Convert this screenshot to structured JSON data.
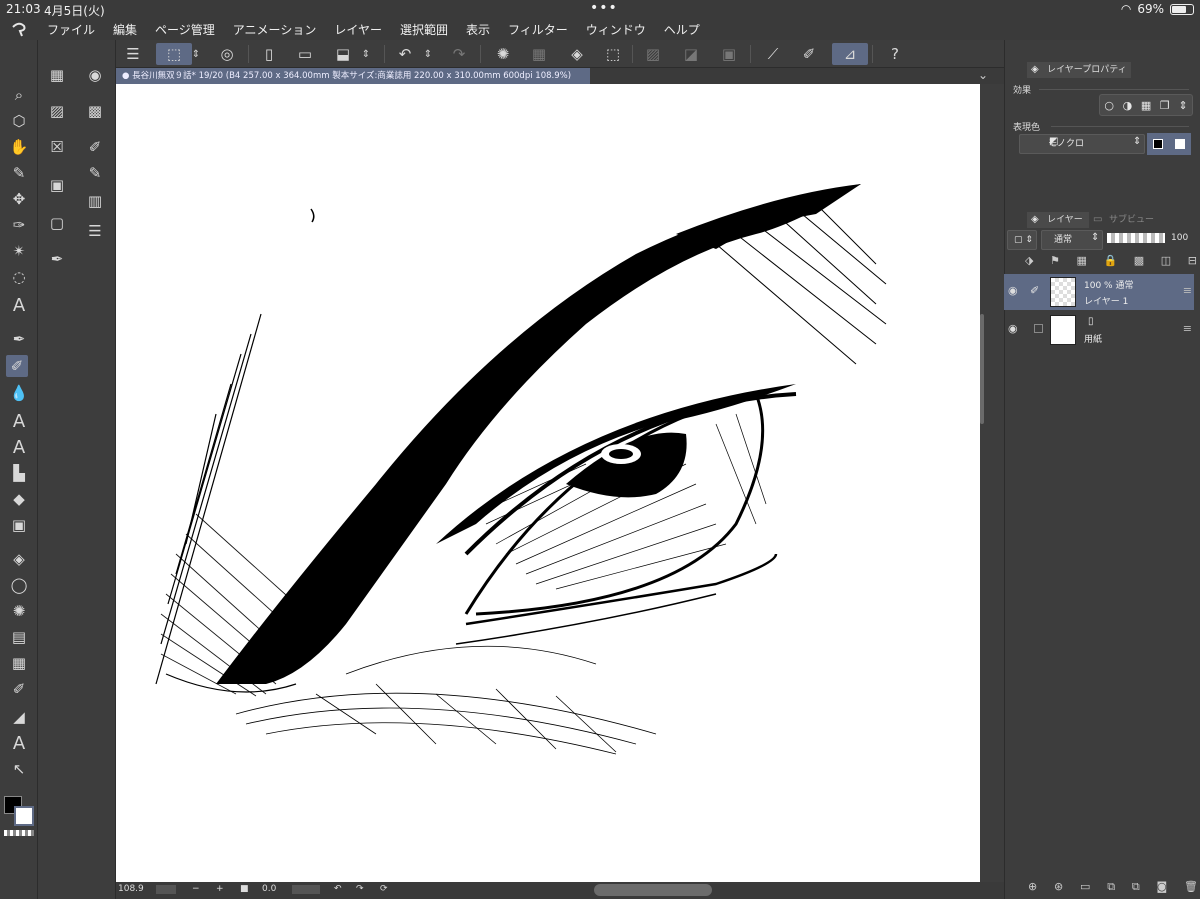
{
  "status_bar": {
    "time": "21:03",
    "date": "4月5日(火)",
    "dots": "•••",
    "battery": "69%",
    "battery_level": 0.69
  },
  "menu": {
    "items": [
      "ファイル",
      "編集",
      "ページ管理",
      "アニメーション",
      "レイヤー",
      "選択範囲",
      "表示",
      "フィルター",
      "ウィンドウ",
      "ヘルプ"
    ]
  },
  "canvas": {
    "document_tab": "長谷川無双９話* 19/20 (B4 257.00 x 364.00mm 製本サイズ:商業誌用 220.00 x 310.00mm 600dpi 108.9%)",
    "zoom": "108.9",
    "rotation": "0.0"
  },
  "layer_property": {
    "tab_label": "レイヤープロパティ",
    "effect_label": "効果",
    "expression_color_label": "表現色",
    "expression_color_value": "モノクロ"
  },
  "layers_panel": {
    "tab_label": "レイヤー",
    "tab2_label": "サブビュー",
    "blend_mode": "通常",
    "opacity": "100",
    "layers": [
      {
        "line1": "100 %  通常",
        "line2": "レイヤー 1",
        "selected": true
      },
      {
        "line1": "",
        "line2": "用紙",
        "selected": false
      }
    ]
  },
  "colors": {
    "accent": "#5e6a85",
    "ui_bg": "#3d3d3d",
    "paper": "#ffffff"
  },
  "icons": {
    "tools": [
      "zoom-icon",
      "operation-icon",
      "hand-icon",
      "eyedropper-icon",
      "move-icon",
      "pen-icon",
      "sparkle-icon",
      "lasso-icon",
      "text-icon",
      "pen-nib-icon",
      "pen-selected-icon",
      "blend-icon",
      "airbrush-icon",
      "decoration-icon",
      "eraser-icon",
      "gradient-icon",
      "fill-icon",
      "balloon-icon",
      "speedlines-icon",
      "frame-icon",
      "pattern-icon",
      "ruler-pen-icon",
      "correction-icon",
      "text-tool-icon",
      "object-select-icon"
    ]
  }
}
